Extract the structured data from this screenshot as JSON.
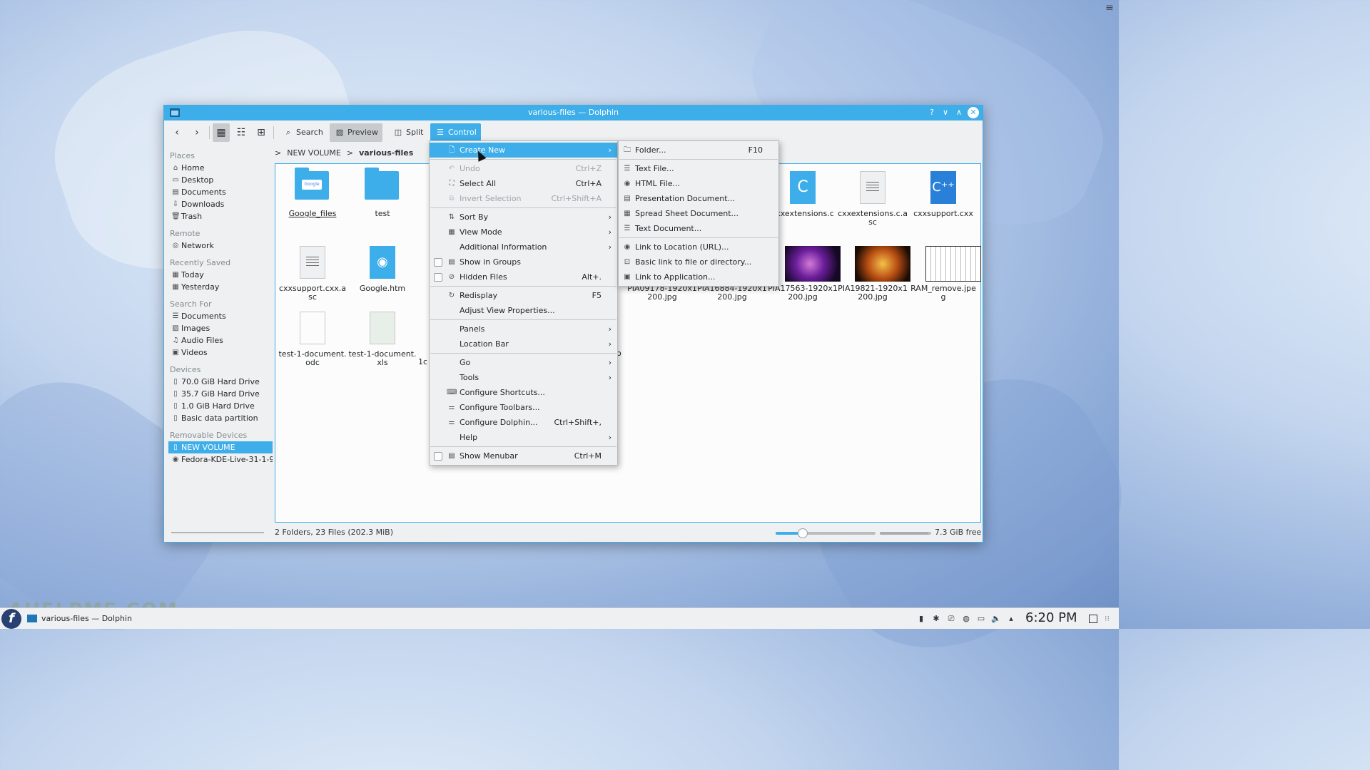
{
  "window": {
    "title": "various-files — Dolphin",
    "help_icon": "?",
    "min_icon": "∨",
    "max_icon": "∧",
    "close_icon": "✕"
  },
  "toolbar": {
    "back": "‹",
    "forward": "›",
    "search_label": "Search",
    "preview_label": "Preview",
    "split_label": "Split",
    "control_label": "Control"
  },
  "sidebar": {
    "places_header": "Places",
    "places": [
      {
        "label": "Home",
        "icon": "⌂"
      },
      {
        "label": "Desktop",
        "icon": "▭"
      },
      {
        "label": "Documents",
        "icon": "▤"
      },
      {
        "label": "Downloads",
        "icon": "⇩"
      },
      {
        "label": "Trash",
        "icon": "🗑"
      }
    ],
    "remote_header": "Remote",
    "remote": [
      {
        "label": "Network",
        "icon": "◎"
      }
    ],
    "recent_header": "Recently Saved",
    "recent": [
      {
        "label": "Today",
        "icon": "▦"
      },
      {
        "label": "Yesterday",
        "icon": "▦"
      }
    ],
    "search_header": "Search For",
    "search": [
      {
        "label": "Documents",
        "icon": "☰"
      },
      {
        "label": "Images",
        "icon": "▨"
      },
      {
        "label": "Audio Files",
        "icon": "♫"
      },
      {
        "label": "Videos",
        "icon": "▣"
      }
    ],
    "devices_header": "Devices",
    "devices": [
      {
        "label": "70.0 GiB Hard Drive",
        "icon": "▯"
      },
      {
        "label": "35.7 GiB Hard Drive",
        "icon": "▯"
      },
      {
        "label": "1.0 GiB Hard Drive",
        "icon": "▯"
      },
      {
        "label": "Basic data partition",
        "icon": "▯"
      }
    ],
    "removable_header": "Removable Devices",
    "removable": [
      {
        "label": "NEW VOLUME",
        "icon": "▯"
      },
      {
        "label": "Fedora-KDE-Live-31-1-9",
        "icon": "◉"
      }
    ]
  },
  "breadcrumb": {
    "sep": ">",
    "parent": "NEW VOLUME",
    "current": "various-files"
  },
  "files": [
    {
      "name": "Google_files",
      "tag": "Google"
    },
    {
      "name": "test"
    },
    {
      "name": "cxxextensions.c"
    },
    {
      "name": "cxxextensions.c.asc"
    },
    {
      "name": "cxxsupport.cxx"
    },
    {
      "name": "cxxsupport.cxx.asc"
    },
    {
      "name": "Google.htm"
    },
    {
      "name": "PIA09178-1920x1200.jpg"
    },
    {
      "name": "PIA16884-1920x1200.jpg"
    },
    {
      "name": "PIA17563-1920x1200.jpg"
    },
    {
      "name": "PIA19821-1920x1200.jpg"
    },
    {
      "name": "RAM_remove.jpeg"
    },
    {
      "name": "test-1-document.odc"
    },
    {
      "name": "test-1-document.xls"
    },
    {
      "name": "1c"
    },
    {
      "name": "o"
    }
  ],
  "status": {
    "summary": "2 Folders, 23 Files (202.3 MiB)",
    "zoom_fraction": 0.27,
    "free_space": "7.3 GiB free",
    "used_fraction": 0.95
  },
  "control_menu": {
    "items": [
      {
        "label": "Create New",
        "icon": "🗋",
        "submenu": true,
        "highlighted": true
      },
      {
        "sep": true
      },
      {
        "label": "Undo",
        "icon": "↶",
        "shortcut": "Ctrl+Z",
        "disabled": true
      },
      {
        "label": "Select All",
        "icon": "⛶",
        "shortcut": "Ctrl+A"
      },
      {
        "label": "Invert Selection",
        "icon": "⧉",
        "shortcut": "Ctrl+Shift+A",
        "disabled": true
      },
      {
        "sep": true
      },
      {
        "label": "Sort By",
        "icon": "⇅",
        "submenu": true
      },
      {
        "label": "View Mode",
        "icon": "▦",
        "submenu": true
      },
      {
        "label": "Additional Information",
        "submenu": true
      },
      {
        "label": "Show in Groups",
        "icon": "▤",
        "checkbox": true
      },
      {
        "label": "Hidden Files",
        "icon": "⊘",
        "checkbox": true,
        "shortcut": "Alt+."
      },
      {
        "sep": true
      },
      {
        "label": "Redisplay",
        "icon": "↻",
        "shortcut": "F5"
      },
      {
        "label": "Adjust View Properties..."
      },
      {
        "sep": true
      },
      {
        "label": "Panels",
        "submenu": true
      },
      {
        "label": "Location Bar",
        "submenu": true
      },
      {
        "sep": true
      },
      {
        "label": "Go",
        "submenu": true
      },
      {
        "label": "Tools",
        "submenu": true
      },
      {
        "label": "Configure Shortcuts...",
        "icon": "⌨"
      },
      {
        "label": "Configure Toolbars...",
        "icon": "⚌"
      },
      {
        "label": "Configure Dolphin...",
        "icon": "⚌",
        "shortcut": "Ctrl+Shift+,"
      },
      {
        "label": "Help",
        "submenu": true
      },
      {
        "sep": true
      },
      {
        "label": "Show Menubar",
        "icon": "▤",
        "checkbox": true,
        "shortcut": "Ctrl+M"
      }
    ]
  },
  "create_new_menu": {
    "items": [
      {
        "label": "Folder...",
        "icon": "🗀",
        "shortcut": "F10"
      },
      {
        "sep": true
      },
      {
        "label": "Text File...",
        "icon": "☰"
      },
      {
        "label": "HTML File...",
        "icon": "◉"
      },
      {
        "label": "Presentation Document...",
        "icon": "▤"
      },
      {
        "label": "Spread Sheet Document...",
        "icon": "▦"
      },
      {
        "label": "Text Document...",
        "icon": "☰"
      },
      {
        "sep": true
      },
      {
        "label": "Link to Location (URL)...",
        "icon": "◉"
      },
      {
        "label": "Basic link to file or directory...",
        "icon": "⊡"
      },
      {
        "label": "Link to Application...",
        "icon": "▣"
      }
    ]
  },
  "taskbar": {
    "start_icon": "f",
    "task_label": "various-files — Dolphin",
    "clock": "6:20 PM",
    "watermark": "AHELPME.COM",
    "tray": [
      "▮",
      "✱",
      "⎚",
      "◍",
      "▭",
      "🔈",
      "▴"
    ]
  },
  "desktop": {
    "menu_icon": "≡"
  },
  "colors": {
    "accent": "#3daee9",
    "window_bg": "#eff0f1",
    "view_bg": "#fcfcfc"
  }
}
